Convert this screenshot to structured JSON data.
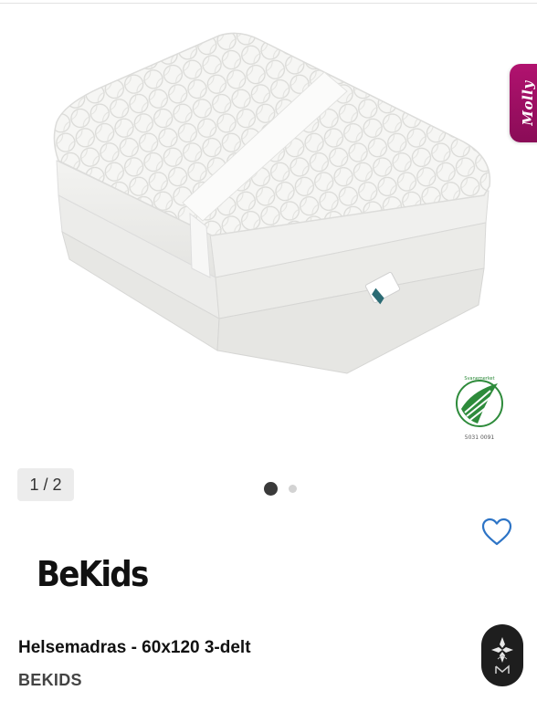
{
  "gallery": {
    "counter": "1 / 2",
    "current": 1,
    "total": 2,
    "image": "folded white quilted foam mattress with strap",
    "eco_label": {
      "name": "Svanemerket",
      "code": "5031 0091"
    }
  },
  "side_tab": {
    "label": "Molly",
    "color": "#a30f66"
  },
  "product": {
    "brand_logo": "BeKids",
    "title": "Helsemadras - 60x120 3-delt",
    "brand": "BEKIDS"
  },
  "icons": {
    "favorite": "heart-outline-icon",
    "assistant": "assistant-logo-icon"
  },
  "colors": {
    "favorite": "#2d74c6",
    "dot_active": "#3a3a3a",
    "dot_inactive": "#d3d3d3",
    "eco_green": "#2e8b3b"
  }
}
